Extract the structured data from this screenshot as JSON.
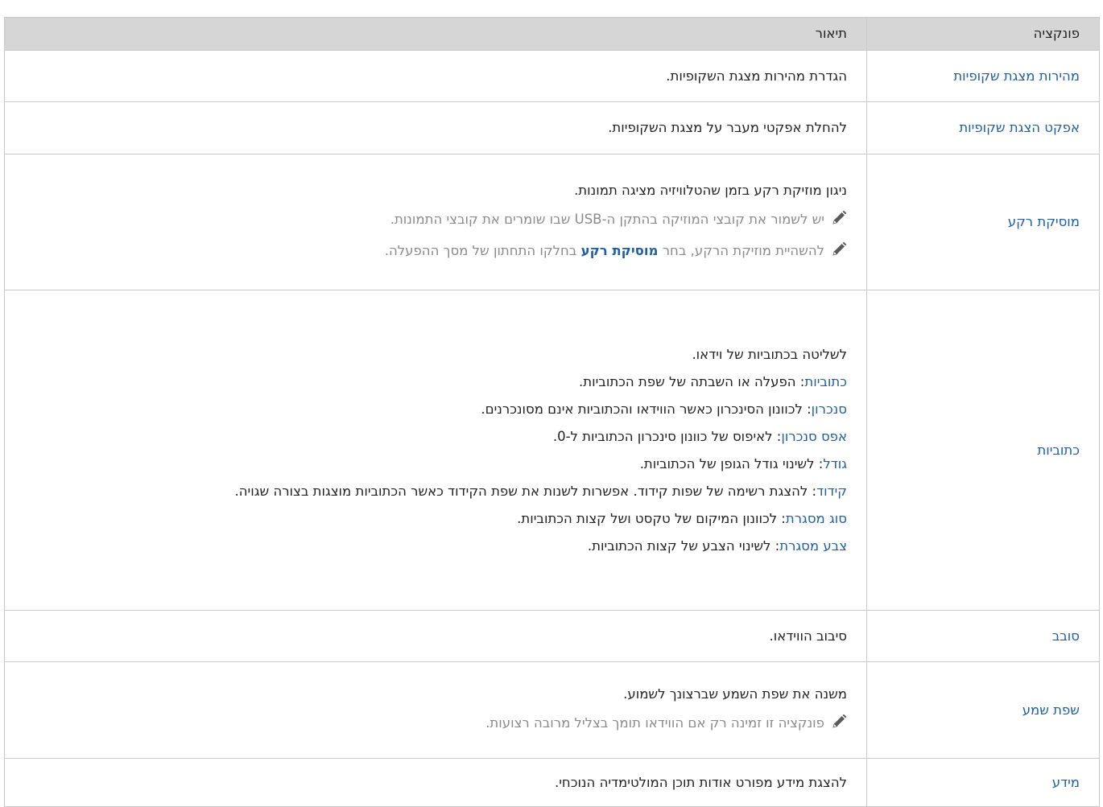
{
  "header": {
    "function": "פונקציה",
    "description": "תיאור"
  },
  "icons": {
    "note": "pencil-icon"
  },
  "colors": {
    "header_bg": "#d6d6d6",
    "link": "#1f5fa3",
    "note": "#8a8a8a",
    "border": "#c9c9c9"
  },
  "rows": [
    {
      "function": "מהירות מצגת שקופיות",
      "description": "הגדרת מהירות מצגת השקופיות."
    },
    {
      "function": "אפקט הצגת שקופיות",
      "description": "להחלת אפקטי מעבר על מצגת השקופיות."
    },
    {
      "function": "מוסיקת רקע",
      "description": "ניגון מוזיקת רקע בזמן שהטלוויזיה מציגה תמונות.",
      "notes": [
        "יש לשמור את קובצי המוזיקה בהתקן ה-USB שבו שומרים את קובצי התמונות.",
        {
          "before": "להשהיית מוזיקת הרקע, בחר ",
          "highlight": "מוסיקת רקע",
          "after": " בחלקו התחתון של מסך ההפעלה."
        }
      ]
    },
    {
      "function": "כתוביות",
      "description": "לשליטה בכתוביות של וידאו.",
      "options": [
        {
          "name": "כתוביות",
          "text": ": הפעלה או השבתה של שפת הכתוביות."
        },
        {
          "name": "סנכרון",
          "text": ": לכוונון הסינכרון כאשר הווידאו והכתוביות אינם מסונכרנים."
        },
        {
          "name": "אפס סנכרון",
          "text": ": לאיפוס של כוונון סינכרון הכתוביות ל-0."
        },
        {
          "name": "גודל",
          "text": ": לשינוי גודל הגופן של הכתוביות."
        },
        {
          "name": "קידוד",
          "text": ": להצגת רשימה של שפות קידוד. אפשרות לשנות את שפת הקידוד כאשר הכתוביות מוצגות בצורה שגויה."
        },
        {
          "name": "סוג מסגרת",
          "text": ": לכוונון המיקום של טקסט ושל קצות הכתוביות."
        },
        {
          "name": "צבע מסגרת",
          "text": ": לשינוי הצבע של קצות הכתוביות."
        }
      ]
    },
    {
      "function": "סובב",
      "description": "סיבוב הווידאו."
    },
    {
      "function": "שפת שמע",
      "description": "משנה את שפת השמע שברצונך לשמוע.",
      "notes": [
        "פונקציה זו זמינה רק אם הווידאו תומך בצליל מרובה רצועות."
      ]
    },
    {
      "function": "מידע",
      "description": "להצגת מידע מפורט אודות תוכן המולטימדיה הנוכחי."
    }
  ]
}
